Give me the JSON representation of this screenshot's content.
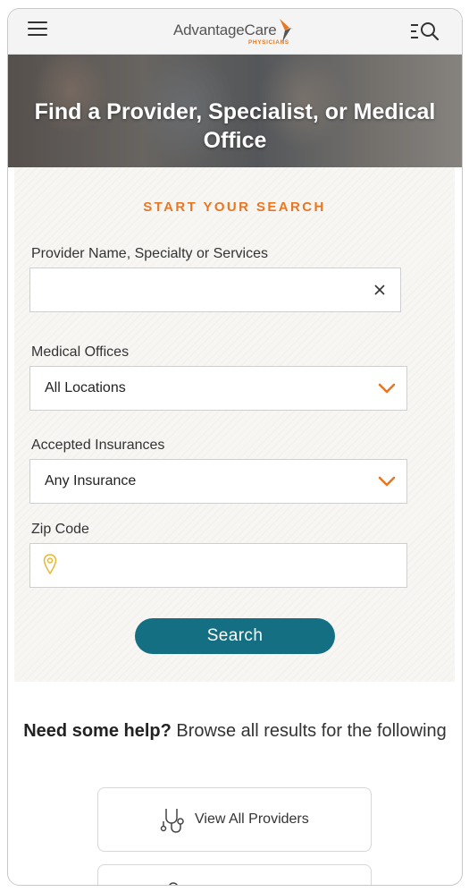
{
  "header": {
    "logo_text": "AdvantageCare",
    "logo_subtext": "PHYSICIANS"
  },
  "hero": {
    "title": "Find a Provider, Specialist, or Medical Office"
  },
  "search": {
    "heading": "START YOUR SEARCH",
    "provider_label": "Provider Name, Specialty or Services",
    "provider_value": "",
    "offices_label": "Medical Offices",
    "offices_value": "All Locations",
    "insurance_label": "Accepted Insurances",
    "insurance_value": "Any Insurance",
    "zip_label": "Zip Code",
    "zip_value": "",
    "button_label": "Search"
  },
  "help": {
    "bold_text": "Need some help?",
    "rest_text": "Browse all results for the following",
    "options": [
      {
        "label": "View All Providers",
        "icon": "stethoscope-icon"
      },
      {
        "label": "",
        "icon": "location-icon"
      }
    ]
  },
  "colors": {
    "accent": "#e87722",
    "button": "#146f82"
  }
}
